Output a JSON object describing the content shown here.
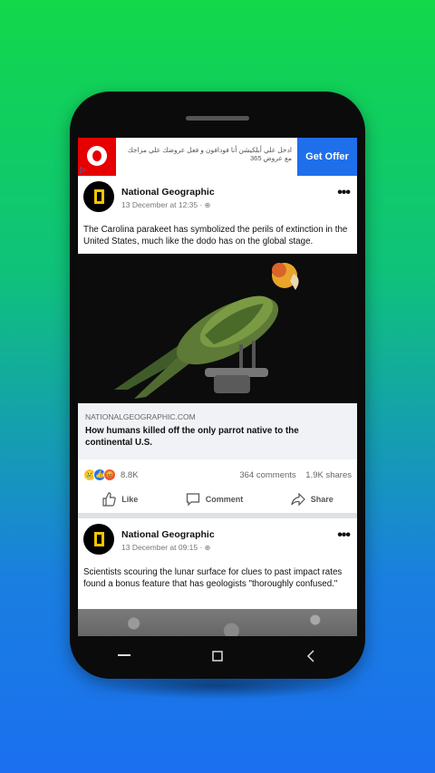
{
  "ad": {
    "text": "ادخل علي أبلكيشن أنا فودافون و فعل عروضك علي مزاجك مع عروض 365",
    "cta": "Get Offer"
  },
  "posts": [
    {
      "page_name": "National Geographic",
      "time": "13 December at 12:35 · ",
      "text": "The Carolina parakeet has symbolized the perils of extinction in the United States, much like the dodo has on the global stage.",
      "link_domain": "NATIONALGEOGRAPHIC.COM",
      "link_title": "How humans killed off the only parrot native to the continental U.S.",
      "reaction_count": "8.8K",
      "comments": "364 comments",
      "shares": "1.9K shares"
    },
    {
      "page_name": "National Geographic",
      "time": "13 December at 09:15 · ",
      "text": "Scientists scouring the lunar surface for clues to past impact rates found a bonus feature that has geologists \"thoroughly confused.\""
    }
  ],
  "actions": {
    "like": "Like",
    "comment": "Comment",
    "share": "Share"
  },
  "icons": {
    "more": "•••",
    "globe": "🌐"
  }
}
